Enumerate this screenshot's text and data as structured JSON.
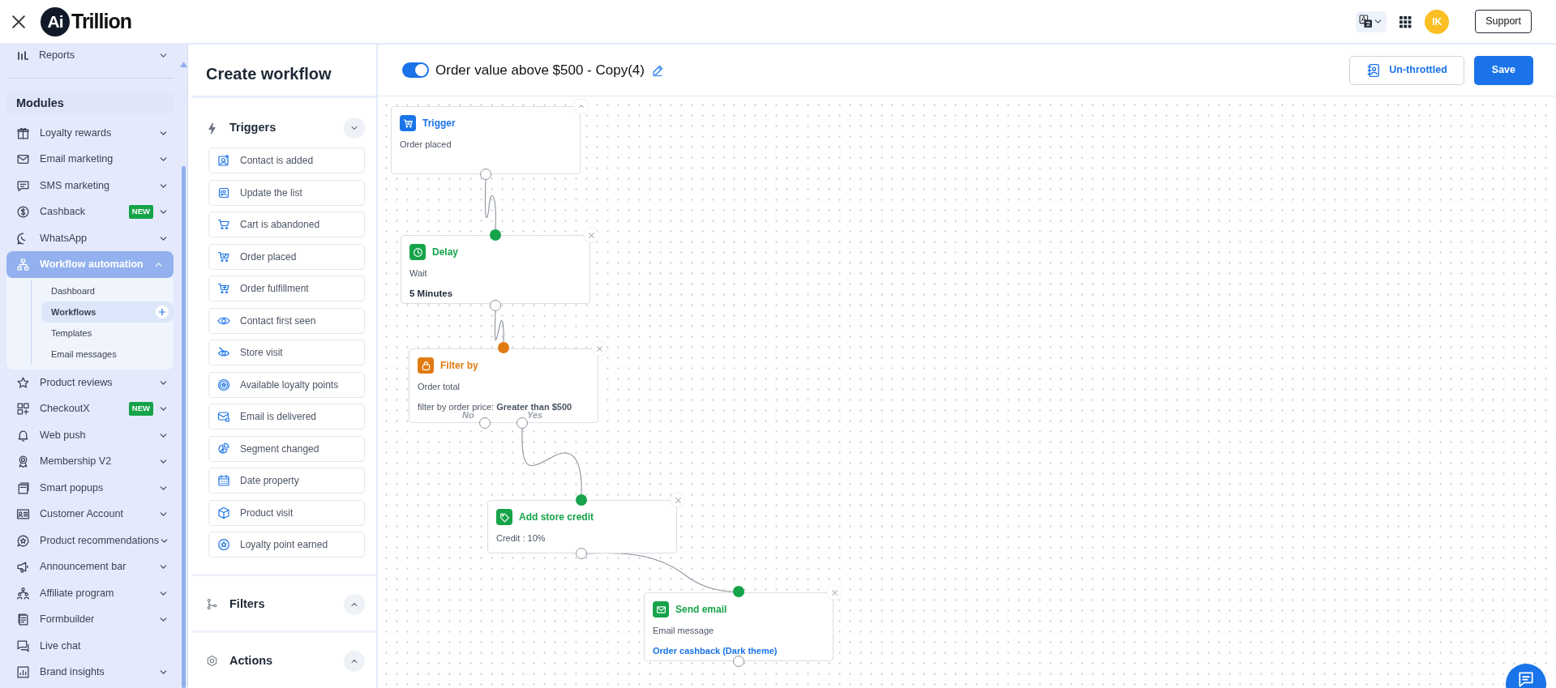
{
  "header": {
    "logo": {
      "mark": "Ai",
      "text": "Trillion"
    },
    "avatar": "IK",
    "support": "Support"
  },
  "sidebar": {
    "top_item": {
      "label": "Reports",
      "expanded": false
    },
    "section": "Modules",
    "items": [
      {
        "label": "Loyalty rewards",
        "kind": "group",
        "expanded": false,
        "selected": false
      },
      {
        "label": "Email marketing",
        "kind": "group",
        "expanded": false,
        "selected": false
      },
      {
        "label": "SMS marketing",
        "kind": "group",
        "expanded": false,
        "selected": false
      },
      {
        "label": "Cashback",
        "kind": "group",
        "badge": "NEW",
        "expanded": false,
        "selected": false
      },
      {
        "label": "WhatsApp",
        "kind": "group",
        "expanded": false,
        "selected": false
      },
      {
        "label": "Workflow automation",
        "kind": "group",
        "expanded": true,
        "selected": true,
        "children": [
          {
            "label": "Dashboard",
            "selected": false
          },
          {
            "label": "Workflows",
            "selected": true
          },
          {
            "label": "Templates",
            "selected": false
          },
          {
            "label": "Email messages",
            "selected": false
          }
        ]
      },
      {
        "label": "Product reviews",
        "kind": "group",
        "expanded": false,
        "selected": false
      },
      {
        "label": "CheckoutX",
        "kind": "group",
        "badge": "NEW",
        "expanded": false,
        "selected": false
      },
      {
        "label": "Web push",
        "kind": "group",
        "expanded": false,
        "selected": false
      },
      {
        "label": "Membership V2",
        "kind": "group",
        "expanded": false,
        "selected": false
      },
      {
        "label": "Smart popups",
        "kind": "group",
        "expanded": false,
        "selected": false
      },
      {
        "label": "Customer Account",
        "kind": "group",
        "expanded": false,
        "selected": false
      },
      {
        "label": "Product recommendations",
        "kind": "group",
        "expanded": false,
        "selected": false
      },
      {
        "label": "Announcement bar",
        "kind": "group",
        "expanded": false,
        "selected": false
      },
      {
        "label": "Affiliate program",
        "kind": "group",
        "expanded": false,
        "selected": false
      },
      {
        "label": "Formbuilder",
        "kind": "group",
        "expanded": false,
        "selected": false
      },
      {
        "label": "Live chat",
        "kind": "link",
        "selected": false
      },
      {
        "label": "Brand insights",
        "kind": "group",
        "expanded": false,
        "selected": false
      }
    ]
  },
  "builder": {
    "title": "Create workflow",
    "sections": [
      {
        "title": "Triggers",
        "expanded": true,
        "items": [
          "Contact is added",
          "Update the list",
          "Cart is abandoned",
          "Order placed",
          "Order fulfillment",
          "Contact first seen",
          "Store visit",
          "Available loyalty points",
          "Email is delivered",
          "Segment changed",
          "Date property",
          "Product visit",
          "Loyalty point earned"
        ]
      },
      {
        "title": "Filters",
        "expanded": false
      },
      {
        "title": "Actions",
        "expanded": false
      }
    ]
  },
  "workflow": {
    "enabled": true,
    "name": "Order value above $500 - Copy(4)",
    "buttons": [
      {
        "label": "Un-throttled",
        "kind": "outline"
      },
      {
        "label": "Save",
        "kind": "primary"
      }
    ]
  },
  "canvas": {
    "nodes": [
      {
        "kind": "trigger",
        "title": "Trigger",
        "lines": [
          {
            "kind": "label",
            "text": "Order placed"
          }
        ]
      },
      {
        "kind": "delay",
        "title": "Delay",
        "lines": [
          {
            "kind": "label",
            "text": "Wait"
          },
          {
            "kind": "value",
            "text": "5 Minutes"
          }
        ]
      },
      {
        "kind": "filter",
        "title": "Filter by",
        "lines": [
          {
            "kind": "label",
            "text": "Order total"
          },
          {
            "kind": "label",
            "text": "filter by order price: **Greater than $500**"
          }
        ],
        "branches": [
          "No",
          "Yes"
        ]
      },
      {
        "kind": "action",
        "title": "Add store credit",
        "lines": [
          {
            "kind": "label",
            "text": "Credit : 10%"
          }
        ]
      },
      {
        "kind": "action",
        "title": "Send email",
        "lines": [
          {
            "kind": "label",
            "text": "Email message"
          },
          {
            "kind": "link",
            "text": "Order cashback (Dark theme)"
          }
        ]
      }
    ]
  }
}
